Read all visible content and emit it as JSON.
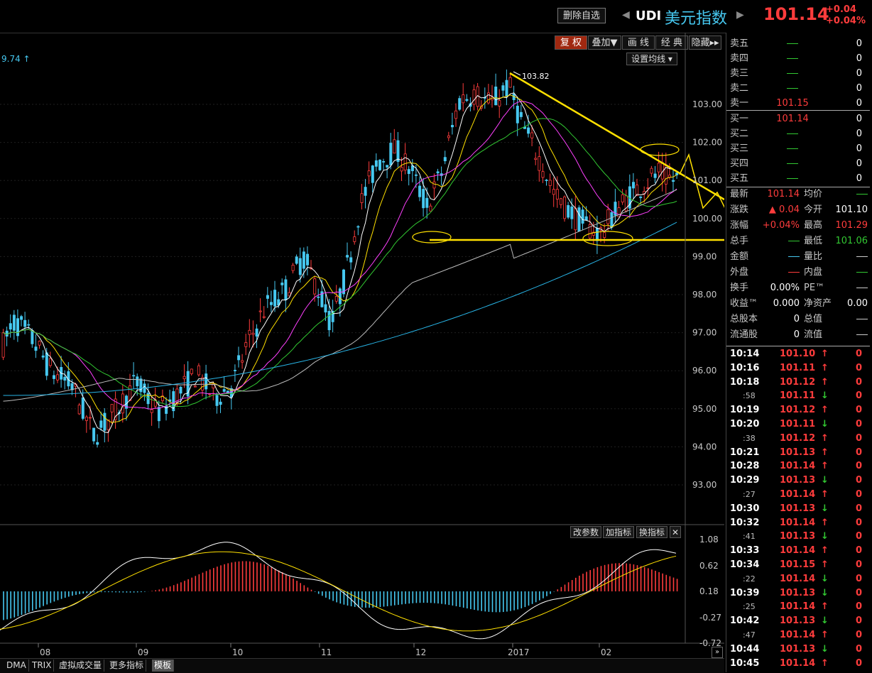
{
  "header": {
    "delete_label": "删除自选",
    "code": "UDI",
    "name": "美元指数",
    "price": "101.14",
    "change": "+0.04",
    "change_pct": "+0.04%"
  },
  "toolbar": {
    "buttons": [
      "复 权",
      "叠加▼",
      "画 线",
      "经 典",
      "隐藏▸▸"
    ],
    "set_ma": "设置均线",
    "ma_readout": "9.74 ↑"
  },
  "chart": {
    "y_ticks": [
      "103.00",
      "102.00",
      "101.00",
      "100.00",
      "99.00",
      "98.00",
      "97.00",
      "96.00",
      "95.00",
      "94.00",
      "93.00"
    ],
    "high_label": "103.82",
    "x_ticks": [
      "08",
      "09",
      "10",
      "11",
      "12",
      "2017",
      "01",
      "02"
    ],
    "indicator_buttons": [
      "改参数",
      "加指标",
      "换指标"
    ],
    "indicator_close": "✕",
    "indicator_ticks": [
      "1.08",
      "0.62",
      "0.18",
      "-0.27",
      "-0.72"
    ]
  },
  "chart_data": {
    "type": "candlestick",
    "x_labels": [
      "08",
      "09",
      "10",
      "11",
      "12",
      "2017",
      "01",
      "02"
    ],
    "y_range": [
      92.5,
      104.0
    ],
    "max_price_label": 103.82,
    "levels": {
      "resistance_start": 103.82,
      "support": 99.4
    },
    "indicator": {
      "type": "macd",
      "range": [
        -0.72,
        1.08
      ],
      "ticks": [
        1.08,
        0.62,
        0.18,
        -0.27,
        -0.72
      ]
    }
  },
  "bottom_tabs": [
    "DMA",
    "TRIX",
    "虚拟成交量",
    "更多指标",
    "模板"
  ],
  "quote": {
    "asks": [
      {
        "label": "卖五",
        "price": "—",
        "vol": "0"
      },
      {
        "label": "卖四",
        "price": "—",
        "vol": "0"
      },
      {
        "label": "卖三",
        "price": "—",
        "vol": "0"
      },
      {
        "label": "卖二",
        "price": "—",
        "vol": "0"
      },
      {
        "label": "卖一",
        "price": "101.15",
        "vol": "0"
      }
    ],
    "bids": [
      {
        "label": "买一",
        "price": "101.14",
        "vol": "0"
      },
      {
        "label": "买二",
        "price": "—",
        "vol": "0"
      },
      {
        "label": "买三",
        "price": "—",
        "vol": "0"
      },
      {
        "label": "买四",
        "price": "—",
        "vol": "0"
      },
      {
        "label": "买五",
        "price": "—",
        "vol": "0"
      }
    ]
  },
  "stats": {
    "latest_l": "最新",
    "latest": "101.14",
    "avg_l": "均价",
    "avg": "—",
    "chg_l": "涨跌",
    "chg": "▲ 0.04",
    "open_l": "今开",
    "open": "101.10",
    "pct_l": "涨幅",
    "pct": "+0.04%",
    "high_l": "最高",
    "high": "101.29",
    "hand_l": "总手",
    "hand": "—",
    "low_l": "最低",
    "low": "101.06",
    "amt_l": "金额",
    "amt": "—",
    "vr_l": "量比",
    "vr": "—",
    "out_l": "外盘",
    "out": "—",
    "in_l": "内盘",
    "in": "—",
    "turn_l": "换手",
    "turn": "0.00%",
    "pe_l": "PE™",
    "pe": "—",
    "ret_l": "收益™",
    "ret": "0.000",
    "nav_l": "净资产",
    "nav": "0.00",
    "cap_l": "总股本",
    "cap": "0",
    "tv_l": "总值",
    "tv": "—",
    "flt_l": "流通股",
    "flt": "0",
    "fv_l": "流值",
    "fv": "—"
  },
  "trades": [
    {
      "time": "10:14",
      "price": "101.10",
      "dir": "↑",
      "vol": "0",
      "sub": false
    },
    {
      "time": "10:16",
      "price": "101.11",
      "dir": "↑",
      "vol": "0",
      "sub": false
    },
    {
      "time": "10:18",
      "price": "101.12",
      "dir": "↑",
      "vol": "0",
      "sub": false
    },
    {
      "time": ":58",
      "price": "101.11",
      "dir": "↓",
      "vol": "0",
      "sub": true
    },
    {
      "time": "10:19",
      "price": "101.12",
      "dir": "↑",
      "vol": "0",
      "sub": false
    },
    {
      "time": "10:20",
      "price": "101.11",
      "dir": "↓",
      "vol": "0",
      "sub": false
    },
    {
      "time": ":38",
      "price": "101.12",
      "dir": "↑",
      "vol": "0",
      "sub": true
    },
    {
      "time": "10:21",
      "price": "101.13",
      "dir": "↑",
      "vol": "0",
      "sub": false
    },
    {
      "time": "10:28",
      "price": "101.14",
      "dir": "↑",
      "vol": "0",
      "sub": false
    },
    {
      "time": "10:29",
      "price": "101.13",
      "dir": "↓",
      "vol": "0",
      "sub": false
    },
    {
      "time": ":27",
      "price": "101.14",
      "dir": "↑",
      "vol": "0",
      "sub": true
    },
    {
      "time": "10:30",
      "price": "101.13",
      "dir": "↓",
      "vol": "0",
      "sub": false
    },
    {
      "time": "10:32",
      "price": "101.14",
      "dir": "↑",
      "vol": "0",
      "sub": false
    },
    {
      "time": ":41",
      "price": "101.13",
      "dir": "↓",
      "vol": "0",
      "sub": true
    },
    {
      "time": "10:33",
      "price": "101.14",
      "dir": "↑",
      "vol": "0",
      "sub": false
    },
    {
      "time": "10:34",
      "price": "101.15",
      "dir": "↑",
      "vol": "0",
      "sub": false
    },
    {
      "time": ":22",
      "price": "101.14",
      "dir": "↓",
      "vol": "0",
      "sub": true
    },
    {
      "time": "10:39",
      "price": "101.13",
      "dir": "↓",
      "vol": "0",
      "sub": false
    },
    {
      "time": ":25",
      "price": "101.14",
      "dir": "↑",
      "vol": "0",
      "sub": true
    },
    {
      "time": "10:42",
      "price": "101.13",
      "dir": "↓",
      "vol": "0",
      "sub": false
    },
    {
      "time": ":47",
      "price": "101.14",
      "dir": "↑",
      "vol": "0",
      "sub": true
    },
    {
      "time": "10:44",
      "price": "101.13",
      "dir": "↓",
      "vol": "0",
      "sub": false
    },
    {
      "time": "10:45",
      "price": "101.14",
      "dir": "↑",
      "vol": "0",
      "sub": false
    }
  ],
  "colors": {
    "up": "#ff3c3c",
    "down": "#46c8f0",
    "trend": "#ffe000",
    "bg": "#000000"
  }
}
